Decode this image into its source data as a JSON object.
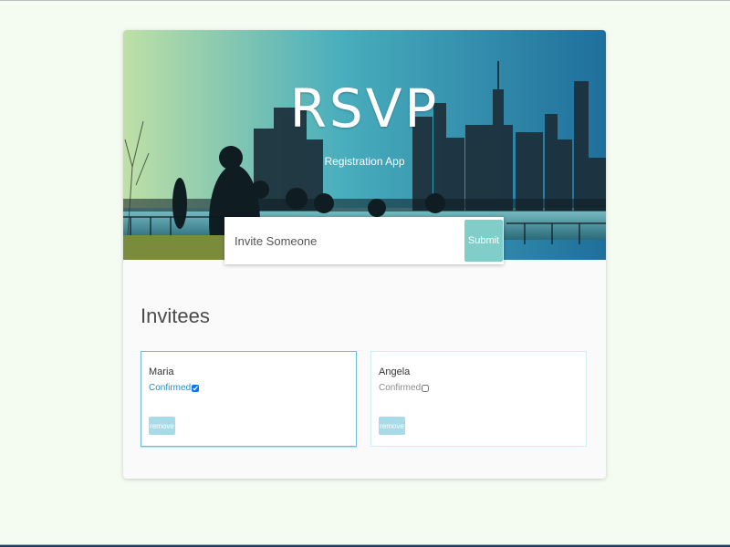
{
  "header": {
    "title": "RSVP",
    "subtitle": "Registration App"
  },
  "invite_form": {
    "placeholder": "Invite Someone",
    "submit_label": "Submit"
  },
  "main": {
    "section_title": "Invitees",
    "invitees": [
      {
        "name": "Maria",
        "confirm_label": "Confirmed",
        "confirmed": true,
        "remove_label": "remove"
      },
      {
        "name": "Angela",
        "confirm_label": "Confirmed",
        "confirmed": false,
        "remove_label": "remove"
      }
    ]
  },
  "colors": {
    "page_background": "#f4fbf1",
    "card_background": "#fafafa",
    "accent": "#80cdc9",
    "confirmed_text": "#2b8cbf",
    "remove_button": "#a7dbe7",
    "selected_border": "#6bbde0"
  }
}
